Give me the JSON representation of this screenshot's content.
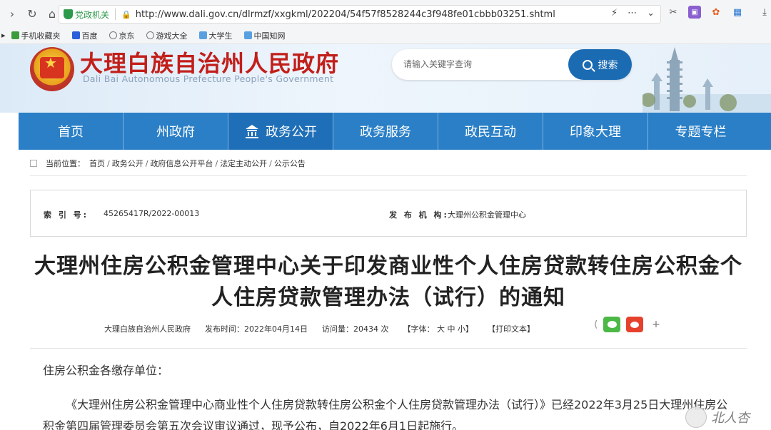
{
  "browser": {
    "gov_tag": "党政机关",
    "url": "http://www.dali.gov.cn/dlrmzf/xxgkml/202204/54f57f8528244c3f948fe01cbbb03251.shtml",
    "bookmarks": [
      "手机收藏夹",
      "百度",
      "京东",
      "游戏大全",
      "大学生",
      "中国知网"
    ]
  },
  "site": {
    "title": "大理白族自治州人民政府",
    "subtitle": "Dali Bai Autonomous Prefecture People's Government",
    "search_placeholder": "请输入关键字查询",
    "search_button": "搜索"
  },
  "nav": {
    "items": [
      "首页",
      "州政府",
      "政务公开",
      "政务服务",
      "政民互动",
      "印象大理",
      "专题专栏"
    ],
    "active": "政务公开"
  },
  "breadcrumb": {
    "label": "当前位置：",
    "items": [
      "首页",
      "政务公开",
      "政府信息公开平台",
      "法定主动公开",
      "公示公告"
    ],
    "separator": "/"
  },
  "meta": {
    "index_label": "索 引 号:",
    "index_value": "45265417R/2022-00013",
    "publisher_label": "发 布 机 构:",
    "publisher_value": "大理州公积金管理中心"
  },
  "article": {
    "title_line1": "大理州住房公积金管理中心关于印发商业性个人住房贷款转住房公积金个",
    "title_line2": "人住房贷款管理办法（试行）的通知",
    "source": "大理白族自治州人民政府",
    "date": "发布时间：2022年04月14日",
    "views": "访问量：20434 次",
    "font_size": "【字体： 大  中  小】",
    "print": "【打印文本】",
    "salutation": "住房公积金各缴存单位：",
    "body": "《大理州住房公积金管理中心商业性个人住房贷款转住房公积金个人住房贷款管理办法（试行）》已经2022年3月25日大理州住房公积金第四届管理委员会第五次会议审议通过，现予公布，自2022年6月1日起施行。"
  },
  "watermark": {
    "text": "北人杏"
  }
}
